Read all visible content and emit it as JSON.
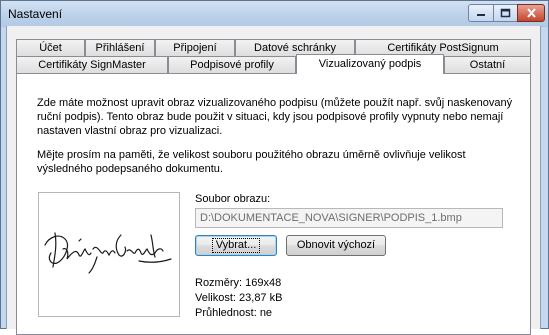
{
  "window": {
    "title": "Nastavení",
    "icons": {
      "minimize": "minimize-icon",
      "maximize": "maximize-icon",
      "close": "close-icon"
    }
  },
  "tabs": {
    "row1": [
      "Účet",
      "Přihlášení",
      "Připojení",
      "Datové schránky",
      "Certifikáty PostSignum"
    ],
    "row2": [
      "Certifikáty SignMaster",
      "Podpisové profily",
      "Vizualizovaný podpis",
      "Ostatní"
    ],
    "active": "Vizualizovaný podpis"
  },
  "content": {
    "intro_lines": [
      "Zde máte možnost upravit obraz vizualizovaného podpisu (můžete použít např. svůj naskenovaný",
      "ruční podpis). Tento obraz bude použit v situaci, kdy jsou podpisové profily vypnuty nebo nemají",
      "nastaven vlastní obraz pro vizualizaci."
    ],
    "note_lines": [
      "Mějte prosím na paměti, že velikost souboru použitého obrazu úměrně ovlivňuje velikost",
      "výsledného podepsaného dokumentu."
    ],
    "file_label": "Soubor obrazu:",
    "file_path": "D:\\DOKUMENTACE_NOVA\\SIGNER\\PODPIS_1.bmp",
    "browse_button": "Vybrat...",
    "restore_button": "Obnovit výchozí",
    "dimensions": "Rozměry: 169x48",
    "size": "Velikost: 23,87 kB",
    "transparency": "Průhlednost: ne"
  }
}
